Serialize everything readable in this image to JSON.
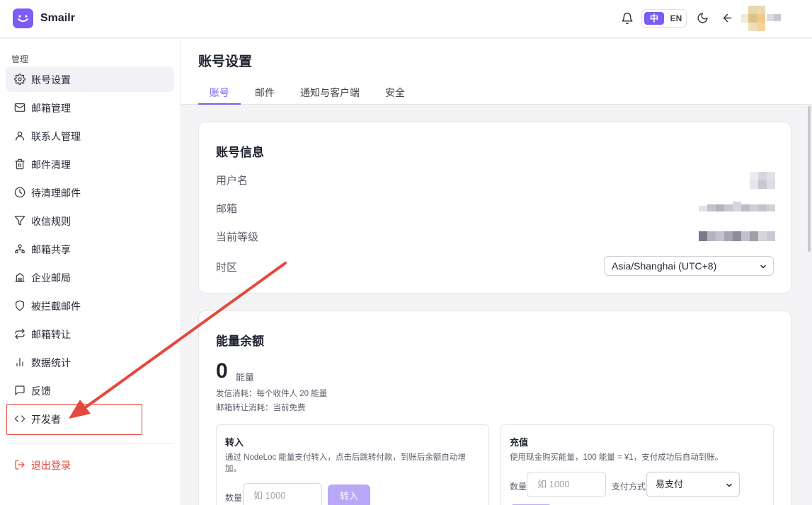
{
  "app": {
    "name": "Smailr"
  },
  "header": {
    "lang_zh": "中",
    "lang_en": "EN"
  },
  "sidebar": {
    "section_title": "管理",
    "items": [
      {
        "label": "账号设置",
        "icon": "gear-icon"
      },
      {
        "label": "邮箱管理",
        "icon": "mail-icon"
      },
      {
        "label": "联系人管理",
        "icon": "user-icon"
      },
      {
        "label": "邮件清理",
        "icon": "trash-icon"
      },
      {
        "label": "待清理邮件",
        "icon": "clock-icon"
      },
      {
        "label": "收信规则",
        "icon": "filter-icon"
      },
      {
        "label": "邮箱共享",
        "icon": "share-icon"
      },
      {
        "label": "企业邮局",
        "icon": "building-icon"
      },
      {
        "label": "被拦截邮件",
        "icon": "shield-icon"
      },
      {
        "label": "邮箱转让",
        "icon": "transfer-icon"
      },
      {
        "label": "数据统计",
        "icon": "bar-chart-icon"
      },
      {
        "label": "反馈",
        "icon": "message-icon"
      },
      {
        "label": "开发者",
        "icon": "code-icon"
      }
    ],
    "logout": "退出登录"
  },
  "main": {
    "title": "账号设置",
    "tabs": [
      "账号",
      "邮件",
      "通知与客户端",
      "安全"
    ],
    "active_tab": "账号",
    "account_info": {
      "title": "账号信息",
      "username_label": "用户名",
      "email_label": "邮箱",
      "level_label": "当前等级",
      "timezone_label": "时区",
      "timezone_value": "Asia/Shanghai (UTC+8)"
    },
    "energy": {
      "title": "能量余额",
      "amount": "0",
      "unit": "能量",
      "send_cost": "发信消耗：每个收件人 20 能量",
      "transfer_cost": "邮箱转让消耗：当前免费",
      "transfer_in": {
        "title": "转入",
        "desc": "通过 NodeLoc 能量支付转入，点击后跳转付款，到账后余额自动增加。",
        "qty_label": "数量",
        "qty_placeholder": "如 1000",
        "button": "转入"
      },
      "recharge": {
        "title": "充值",
        "desc": "使用现金购买能量，100 能量 = ¥1，支付成功后自动到账。",
        "qty_label": "数量",
        "qty_placeholder": "如 1000",
        "pay_label": "支付方式",
        "pay_value": "易支付"
      }
    }
  },
  "colors": {
    "accent": "#7c5cf4",
    "danger": "#e5483c",
    "annotation": "#e5483c"
  }
}
